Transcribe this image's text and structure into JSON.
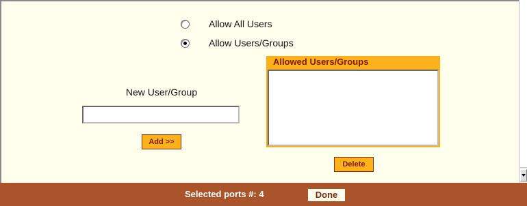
{
  "access": {
    "options": [
      {
        "label": "Allow All Users",
        "checked": false
      },
      {
        "label": "Allow Users/Groups",
        "checked": true
      }
    ]
  },
  "new_user": {
    "label": "New User/Group",
    "value": "",
    "add_button": "Add >>"
  },
  "allowed": {
    "title": "Allowed Users/Groups",
    "items": [],
    "delete_button": "Delete"
  },
  "footer": {
    "selected_ports_label": "Selected ports #: 4",
    "done_button": "Done"
  },
  "colors": {
    "panel_background": "#ffffee",
    "button_orange": "#ffb11c",
    "footer_brown": "#a9542a",
    "button_text": "#7a1a00"
  }
}
